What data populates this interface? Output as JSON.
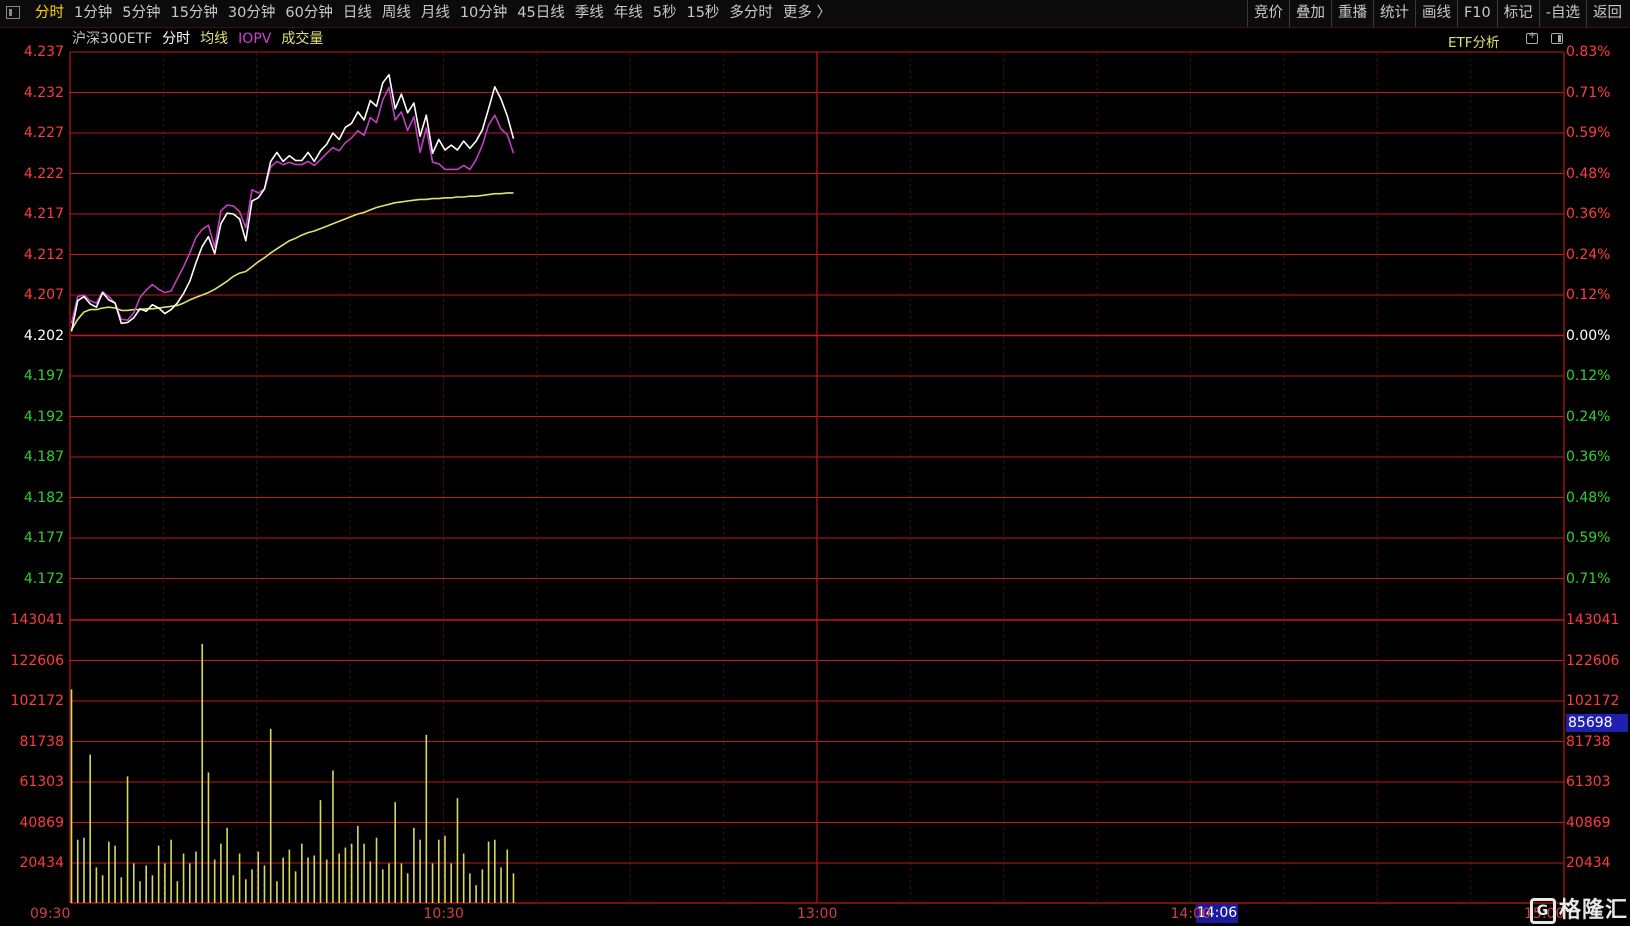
{
  "toolbar": {
    "tabs": [
      "分时",
      "1分钟",
      "5分钟",
      "15分钟",
      "30分钟",
      "60分钟",
      "日线",
      "周线",
      "月线",
      "10分钟",
      "45日线",
      "季线",
      "年线",
      "5秒",
      "15秒",
      "多分时",
      "更多 〉"
    ],
    "active_tab": "分时",
    "right": [
      "竞价",
      "叠加",
      "重播",
      "统计",
      "画线",
      "F10",
      "标记",
      "-自选",
      "返回"
    ]
  },
  "legend": {
    "name": "沪深300ETF",
    "fs": "分时",
    "avg": "均线",
    "iopv": "IOPV",
    "vol": "成交量"
  },
  "etf_button": "ETF分析",
  "colors": {
    "grid": "#c01818",
    "grid_dash": "#3a1010",
    "up": "#ff3c3c",
    "down": "#30d030",
    "neutral": "#ffffff",
    "price_line": "#ffffff",
    "iopv_line": "#c040c0",
    "avg_line": "#e0e070",
    "volume": "#d8d860"
  },
  "price_axis": {
    "left": [
      "4.237",
      "4.232",
      "4.227",
      "4.222",
      "4.217",
      "4.212",
      "4.207",
      "4.202",
      "4.197",
      "4.192",
      "4.187",
      "4.182",
      "4.177",
      "4.172"
    ],
    "right": [
      "0.83%",
      "0.71%",
      "0.59%",
      "0.48%",
      "0.36%",
      "0.24%",
      "0.12%",
      "0.00%",
      "0.12%",
      "0.24%",
      "0.36%",
      "0.48%",
      "0.59%",
      "0.71%"
    ],
    "prev_close": 4.202,
    "max": 4.237,
    "min": 4.172
  },
  "volume_axis": {
    "labels": [
      "143041",
      "122606",
      "102172",
      "81738",
      "61303",
      "40869",
      "20434"
    ],
    "max": 143041,
    "cursor_value": "85698"
  },
  "time_axis": {
    "labels": [
      "09:30",
      "10:30",
      "13:00",
      "14:00",
      "15:00"
    ],
    "cursor_time": "14:06"
  },
  "watermark": "格隆汇",
  "chart_data": {
    "type": "line",
    "minutes_total": 240,
    "x_minute_index": [
      0,
      1,
      2,
      3,
      4,
      5,
      6,
      7,
      8,
      9,
      10,
      11,
      12,
      13,
      14,
      15,
      16,
      17,
      18,
      19,
      20,
      21,
      22,
      23,
      24,
      25,
      26,
      27,
      28,
      29,
      30,
      31,
      32,
      33,
      34,
      35,
      36,
      37,
      38,
      39,
      40,
      41,
      42,
      43,
      44,
      45,
      46,
      47,
      48,
      49,
      50,
      51,
      52,
      53,
      54,
      55,
      56,
      57,
      58,
      59,
      60,
      61,
      62,
      63,
      64,
      65,
      66,
      67,
      68,
      69,
      70,
      71
    ],
    "series": [
      {
        "name": "分时",
        "values": [
          4.2025,
          4.2063,
          4.2068,
          4.2059,
          4.2055,
          4.2073,
          4.2064,
          4.206,
          4.2035,
          4.2036,
          4.2042,
          4.2053,
          4.205,
          4.2058,
          4.2054,
          4.2047,
          4.2052,
          4.206,
          4.2072,
          4.2087,
          4.211,
          4.213,
          4.2142,
          4.2121,
          4.2158,
          4.2171,
          4.217,
          4.2164,
          4.2137,
          4.2186,
          4.219,
          4.2201,
          4.2235,
          4.2246,
          4.2235,
          4.2242,
          4.2236,
          4.2236,
          4.2246,
          4.2235,
          4.2248,
          4.2256,
          4.227,
          4.2262,
          4.2277,
          4.2282,
          4.2296,
          4.2286,
          4.231,
          4.2303,
          4.2332,
          4.2342,
          4.23,
          4.2318,
          4.2295,
          4.2307,
          4.2266,
          4.2292,
          4.2245,
          4.2262,
          4.2249,
          4.2255,
          4.2249,
          4.226,
          4.2251,
          4.226,
          4.2274,
          4.23,
          4.2327,
          4.2312,
          4.2291,
          4.2263
        ]
      },
      {
        "name": "IOPV",
        "values": [
          4.2035,
          4.2068,
          4.207,
          4.2063,
          4.206,
          4.2074,
          4.2068,
          4.206,
          4.204,
          4.2039,
          4.2048,
          4.2067,
          4.2076,
          4.2083,
          4.2077,
          4.2073,
          4.2075,
          4.209,
          4.2105,
          4.2122,
          4.2141,
          4.2151,
          4.2156,
          4.2129,
          4.2174,
          4.2181,
          4.218,
          4.2173,
          4.2153,
          4.22,
          4.2196,
          4.2201,
          4.2228,
          4.2235,
          4.2231,
          4.2234,
          4.2231,
          4.2231,
          4.2235,
          4.223,
          4.2237,
          4.2245,
          4.2252,
          4.2248,
          4.2258,
          4.2264,
          4.2273,
          4.2267,
          4.2289,
          4.2283,
          4.2311,
          4.2326,
          4.2286,
          4.2296,
          4.2273,
          4.229,
          4.2246,
          4.2276,
          4.2234,
          4.2232,
          4.2225,
          4.2225,
          4.2225,
          4.223,
          4.2225,
          4.2237,
          4.2255,
          4.228,
          4.2292,
          4.2275,
          4.2268,
          4.2245
        ]
      },
      {
        "name": "均线",
        "values": [
          4.2027,
          4.204,
          4.2049,
          4.2052,
          4.2052,
          4.2054,
          4.2055,
          4.2054,
          4.2051,
          4.2051,
          4.2052,
          4.2052,
          4.2053,
          4.2053,
          4.2054,
          4.2055,
          4.2056,
          4.2057,
          4.206,
          4.2064,
          4.2067,
          4.207,
          4.2073,
          4.2077,
          4.2082,
          4.2087,
          4.2093,
          4.2097,
          4.2099,
          4.2105,
          4.2111,
          4.2116,
          4.2122,
          4.2127,
          4.2132,
          4.2137,
          4.214,
          4.2144,
          4.2147,
          4.2149,
          4.2152,
          4.2155,
          4.2158,
          4.2161,
          4.2164,
          4.2167,
          4.217,
          4.2172,
          4.2175,
          4.2178,
          4.218,
          4.2182,
          4.2184,
          4.2185,
          4.2186,
          4.2187,
          4.2188,
          4.2188,
          4.2189,
          4.2189,
          4.219,
          4.219,
          4.2191,
          4.2191,
          4.2192,
          4.2192,
          4.2193,
          4.2194,
          4.2195,
          4.2195,
          4.2196,
          4.2196
        ]
      }
    ],
    "volume": [
      108000,
      32000,
      33000,
      75000,
      18000,
      14000,
      31000,
      29000,
      13000,
      64000,
      20000,
      11000,
      19000,
      14000,
      29000,
      20000,
      32000,
      11000,
      25000,
      20000,
      26000,
      131000,
      66000,
      22000,
      30000,
      38000,
      14000,
      25000,
      12000,
      17000,
      26000,
      19000,
      88000,
      11000,
      23000,
      27000,
      16000,
      30000,
      23000,
      24000,
      52000,
      22000,
      67000,
      25000,
      28000,
      30000,
      39000,
      30000,
      21000,
      33000,
      17000,
      20000,
      51000,
      20000,
      15000,
      38000,
      32000,
      85000,
      20000,
      32000,
      34000,
      20000,
      53000,
      25000,
      15000,
      9000,
      17000,
      31000,
      32000,
      18000,
      27000,
      15000
    ]
  }
}
